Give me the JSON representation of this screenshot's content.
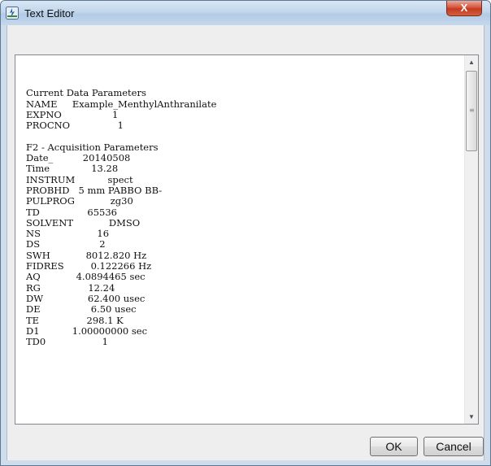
{
  "window": {
    "title": "Text Editor",
    "close_label": "X"
  },
  "editor": {
    "lines": [
      "",
      "Current Data Parameters",
      "NAME     Example_MenthylAnthranilate",
      "EXPNO                 1",
      "PROCNO                1",
      "",
      "F2 - Acquisition Parameters",
      "Date_          20140508",
      "Time              13.28",
      "INSTRUM           spect",
      "PROBHD   5 mm PABBO BB-",
      "PULPROG            zg30",
      "TD                65536",
      "SOLVENT            DMSO",
      "NS                   16",
      "DS                    2",
      "SWH            8012.820 Hz",
      "FIDRES         0.122266 Hz",
      "AQ            4.0894465 sec",
      "RG                12.24",
      "DW               62.400 usec",
      "DE                 6.50 usec",
      "TE                298.1 K",
      "D1           1.00000000 sec",
      "TD0                   1"
    ]
  },
  "buttons": {
    "ok": "OK",
    "cancel": "Cancel"
  },
  "scrollbar": {
    "up_arrow": "▲",
    "down_arrow": "▼",
    "grip": "≡"
  },
  "colors": {
    "title_bar": "#c2d6ec",
    "close_button": "#c8432a",
    "window_body": "#eeeeee"
  }
}
